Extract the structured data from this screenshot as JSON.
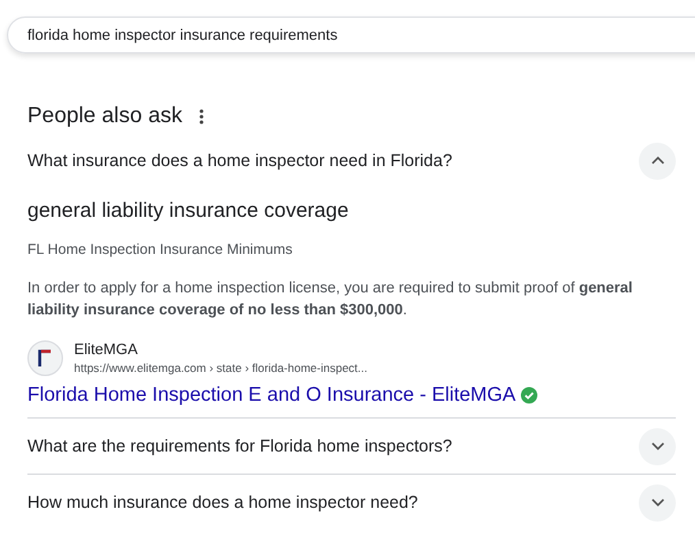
{
  "search": {
    "value": "florida home inspector insurance requirements"
  },
  "section_title": "People also ask",
  "questions": [
    {
      "text": "What insurance does a home inspector need in Florida?",
      "expanded": true,
      "answer": {
        "title": "general liability insurance coverage",
        "subtitle": "FL Home Inspection Insurance Minimums",
        "body": "In order to apply for a home inspection license, you are required to submit proof of **general liability insurance coverage of no less than $300,000**.",
        "source": {
          "name": "EliteMGA",
          "url": "https://www.elitemga.com › state › florida-home-inspect...",
          "link": "Florida Home Inspection E and O Insurance - EliteMGA",
          "verified": true
        }
      }
    },
    {
      "text": "What are the requirements for Florida home inspectors?",
      "expanded": false
    },
    {
      "text": "How much insurance does a home inspector need?",
      "expanded": false
    }
  ]
}
